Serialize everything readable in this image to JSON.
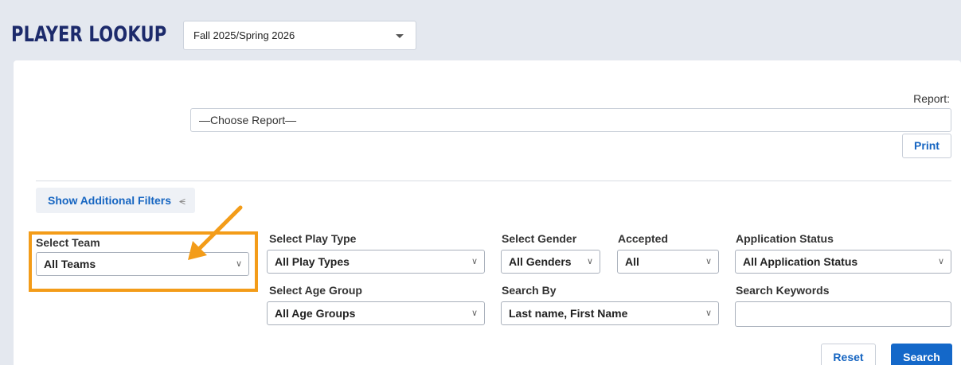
{
  "header": {
    "title": "PLAYER LOOKUP",
    "season": "Fall 2025/Spring 2026"
  },
  "report": {
    "label": "Report:",
    "selected": "—Choose Report—",
    "print_label": "Print"
  },
  "filters": {
    "toggle_label": "Show Additional Filters",
    "team": {
      "label": "Select Team",
      "value": "All Teams"
    },
    "play_type": {
      "label": "Select Play Type",
      "value": "All Play Types"
    },
    "gender": {
      "label": "Select Gender",
      "value": "All Genders"
    },
    "accepted": {
      "label": "Accepted",
      "value": "All"
    },
    "application_status": {
      "label": "Application Status",
      "value": "All Application Status"
    },
    "age_group": {
      "label": "Select Age Group",
      "value": "All Age Groups"
    },
    "search_by": {
      "label": "Search By",
      "value": "Last name, First Name"
    },
    "keywords": {
      "label": "Search Keywords",
      "value": ""
    }
  },
  "actions": {
    "reset_label": "Reset",
    "search_label": "Search"
  },
  "colors": {
    "accent": "#1468c9",
    "title": "#1c2a6b",
    "highlight": "#f39c19"
  }
}
